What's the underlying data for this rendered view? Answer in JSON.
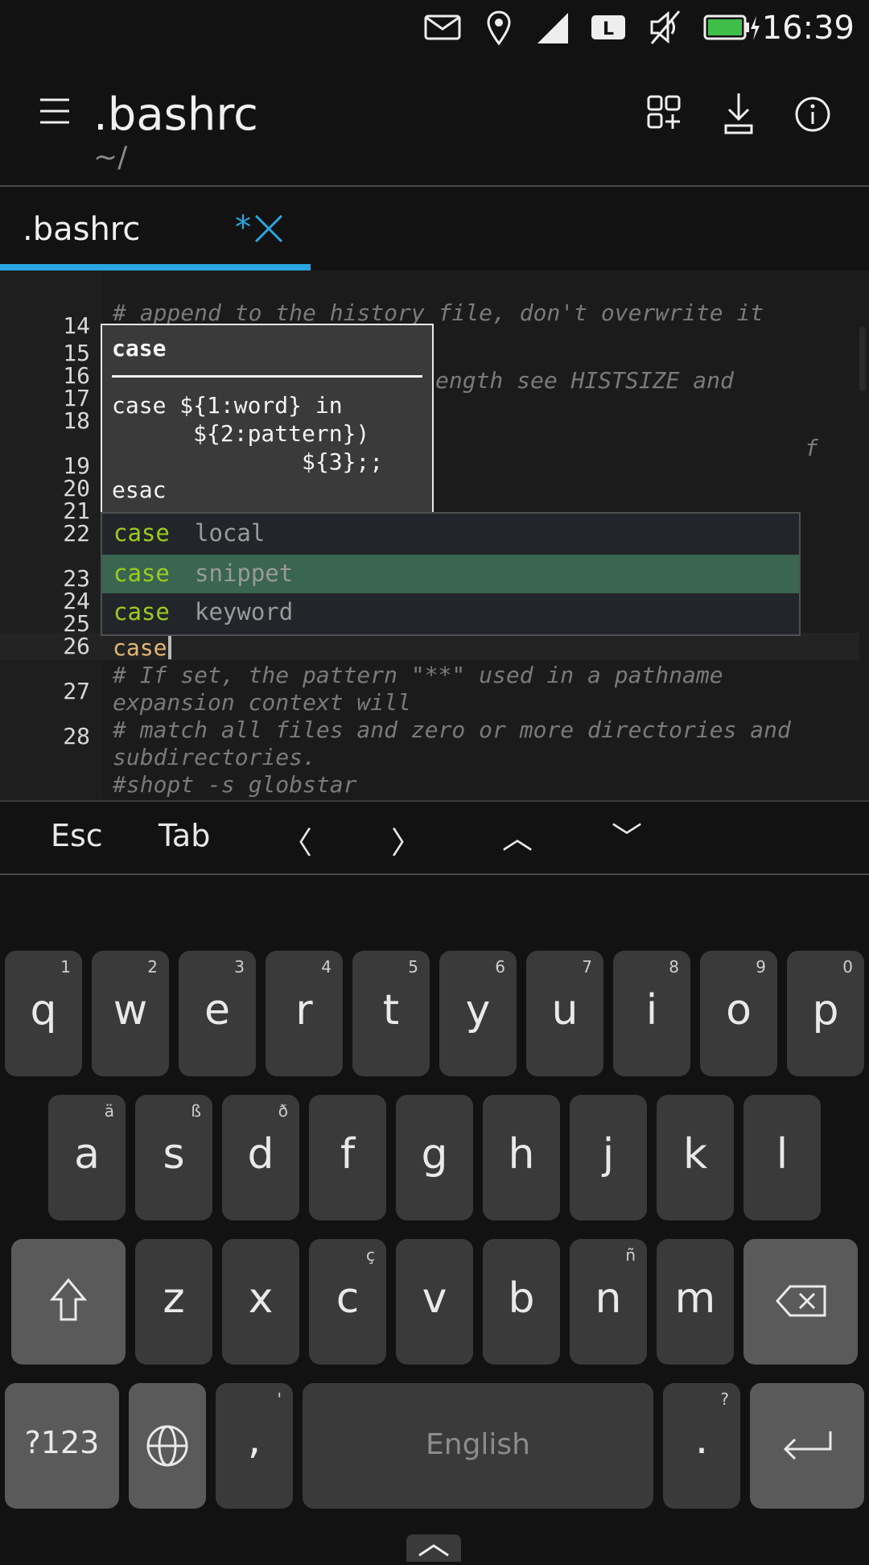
{
  "status": {
    "time": "16:39"
  },
  "header": {
    "title": ".bashrc",
    "subtitle": "~/"
  },
  "tab": {
    "label": ".bashrc",
    "modified": "*"
  },
  "editor": {
    "line_numbers": [
      "14",
      "15",
      "16",
      "17",
      "18",
      "19",
      "20",
      "21",
      "22",
      "23",
      "24",
      "25",
      "26",
      "27",
      "28"
    ],
    "lines": {
      "l15": "# append to the history file, don't overwrite it",
      "l18": "ength see HISTSIZE and",
      "l22": "f",
      "l25": "case",
      "l26a": "# If set, the pattern \"**\" used in a pathname",
      "l26b": "expansion context will",
      "l27a": "# match all files and zero or more directories and",
      "l27b": "subdirectories.",
      "l28": "#shopt -s globstar"
    }
  },
  "snippet": {
    "heading": "case",
    "body": "case ${1:word} in\n      ${2:pattern})\n              ${3};;\nesac"
  },
  "completions": [
    {
      "keyword": "case",
      "type": "local"
    },
    {
      "keyword": "case",
      "type": "snippet"
    },
    {
      "keyword": "case",
      "type": "keyword"
    }
  ],
  "keybar": {
    "esc": "Esc",
    "tab": "Tab",
    "left": "〈",
    "right": "〉",
    "up": "︿",
    "down": "﹀"
  },
  "keyboard": {
    "row1": [
      {
        "k": "q",
        "h": "1"
      },
      {
        "k": "w",
        "h": "2"
      },
      {
        "k": "e",
        "h": "3"
      },
      {
        "k": "r",
        "h": "4"
      },
      {
        "k": "t",
        "h": "5"
      },
      {
        "k": "y",
        "h": "6"
      },
      {
        "k": "u",
        "h": "7"
      },
      {
        "k": "i",
        "h": "8"
      },
      {
        "k": "o",
        "h": "9"
      },
      {
        "k": "p",
        "h": "0"
      }
    ],
    "row2": [
      {
        "k": "a",
        "h": "ä"
      },
      {
        "k": "s",
        "h": "ß"
      },
      {
        "k": "d",
        "h": "ð"
      },
      {
        "k": "f",
        "h": ""
      },
      {
        "k": "g",
        "h": ""
      },
      {
        "k": "h",
        "h": ""
      },
      {
        "k": "j",
        "h": ""
      },
      {
        "k": "k",
        "h": ""
      },
      {
        "k": "l",
        "h": ""
      }
    ],
    "row3": [
      {
        "k": "z",
        "h": ""
      },
      {
        "k": "x",
        "h": ""
      },
      {
        "k": "c",
        "h": "ç"
      },
      {
        "k": "v",
        "h": ""
      },
      {
        "k": "b",
        "h": ""
      },
      {
        "k": "n",
        "h": "ñ"
      },
      {
        "k": "m",
        "h": ""
      }
    ],
    "symbols": "?123",
    "comma": ",",
    "comma_hint": "'",
    "space": "English",
    "period": ".",
    "period_hint": "?"
  }
}
